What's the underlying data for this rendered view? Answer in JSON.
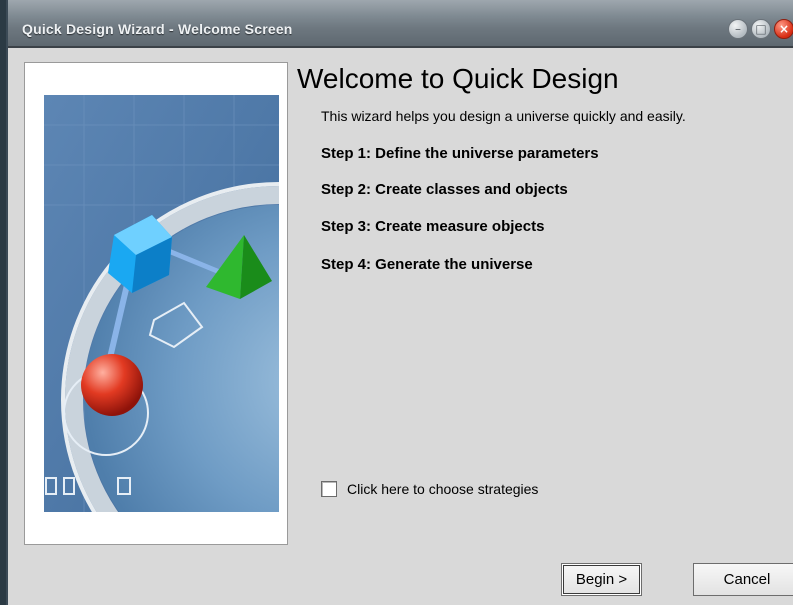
{
  "window": {
    "title": "Quick Design Wizard - Welcome Screen",
    "controls": [
      "minimize-icon",
      "maximize-icon",
      "close-icon"
    ]
  },
  "content": {
    "heading": "Welcome to Quick Design",
    "intro": "This wizard helps you design a universe quickly and easily.",
    "steps": [
      "Step 1: Define the universe parameters",
      "Step 2: Create classes and objects",
      "Step 3: Create measure objects",
      "Step 4: Generate the universe"
    ],
    "strategies_checkbox": {
      "label": "Click here to choose strategies",
      "checked": false
    }
  },
  "buttons": {
    "begin": "Begin >",
    "cancel": "Cancel"
  },
  "colors": {
    "title_bar": "#7f8a92",
    "dialog_bg": "#d9d9d9",
    "close_button": "#d62b12"
  }
}
